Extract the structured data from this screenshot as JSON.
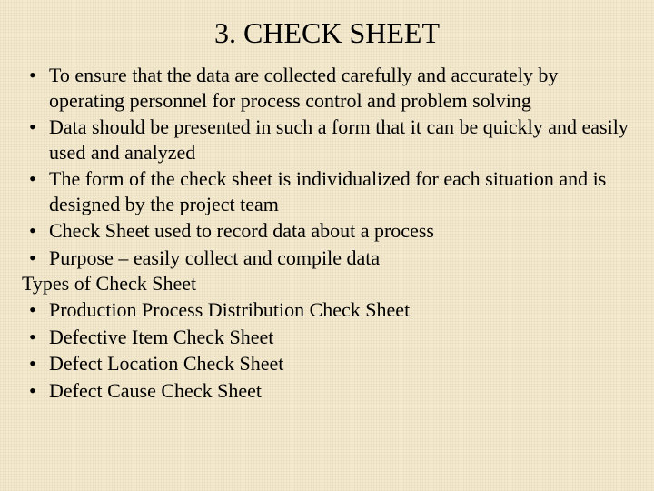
{
  "title": "3. CHECK SHEET",
  "bullets_a": [
    "To ensure that the data are collected carefully and accurately by operating personnel for process control and problem solving",
    "Data should be presented in such a form that it can be quickly and easily used and analyzed",
    "The form of the check sheet is individualized for each situation and is designed by the project team",
    "Check Sheet used to record data about a process",
    "Purpose – easily collect and compile data"
  ],
  "subhead": "Types of Check Sheet",
  "bullets_b": [
    "Production Process Distribution Check Sheet",
    "Defective Item Check Sheet",
    "Defect Location Check Sheet",
    "Defect Cause Check Sheet"
  ]
}
